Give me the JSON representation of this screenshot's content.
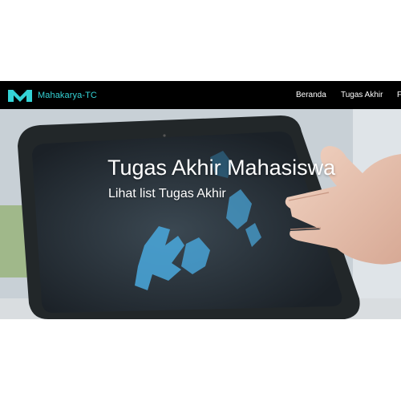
{
  "navbar": {
    "brand": {
      "logo_icon": "m-logo-icon",
      "name": "Mahakarya-TC",
      "color": "#34d3d6"
    },
    "items": [
      {
        "label": "Beranda"
      },
      {
        "label": "Tugas Akhir"
      },
      {
        "label": "F"
      }
    ]
  },
  "hero": {
    "title": "Tugas Akhir Mahasiswa",
    "subtitle": "Lihat list Tugas Akhir",
    "image": "tablet-hand-photo"
  }
}
